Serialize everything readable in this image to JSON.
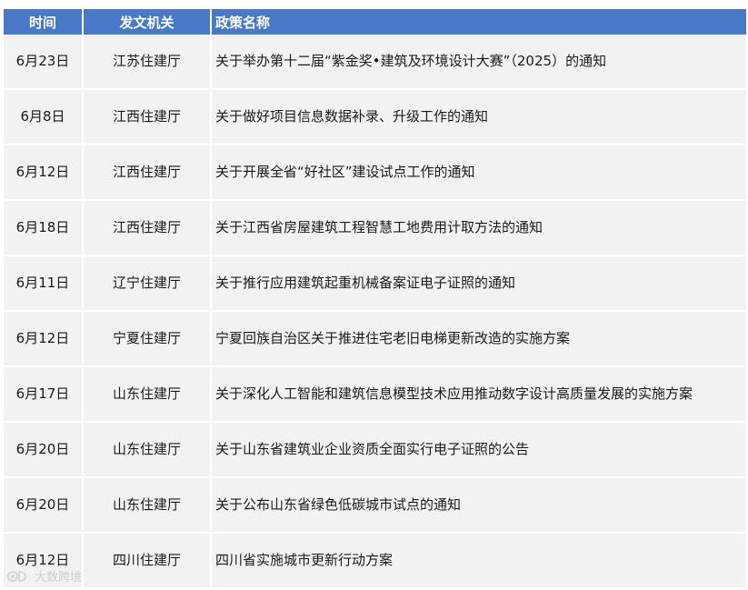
{
  "header": {
    "date": "时间",
    "org": "发文机关",
    "name": "政策名称"
  },
  "rows": [
    {
      "date": "6月23日",
      "org": "江苏住建厅",
      "name": "关于举办第十二届“紫金奖•建筑及环境设计大赛”（2025）的通知"
    },
    {
      "date": "6月8日",
      "org": "江西住建厅",
      "name": "关于做好项目信息数据补录、升级工作的通知"
    },
    {
      "date": "6月12日",
      "org": "江西住建厅",
      "name": "关于开展全省“好社区”建设试点工作的通知"
    },
    {
      "date": "6月18日",
      "org": "江西住建厅",
      "name": "关于江西省房屋建筑工程智慧工地费用计取方法的通知"
    },
    {
      "date": "6月11日",
      "org": "辽宁住建厅",
      "name": "关于推行应用建筑起重机械备案证电子证照的通知"
    },
    {
      "date": "6月12日",
      "org": "宁夏住建厅",
      "name": "宁夏回族自治区关于推进住宅老旧电梯更新改造的实施方案"
    },
    {
      "date": "6月17日",
      "org": "山东住建厅",
      "name": "关于深化人工智能和建筑信息模型技术应用推动数字设计高质量发展的实施方案"
    },
    {
      "date": "6月20日",
      "org": "山东住建厅",
      "name": "关于山东省建筑业企业资质全面实行电子证照的公告"
    },
    {
      "date": "6月20日",
      "org": "山东住建厅",
      "name": "关于公布山东省绿色低碳城市试点的通知"
    },
    {
      "date": "6月12日",
      "org": "四川住建厅",
      "name": "四川省实施城市更新行动方案"
    }
  ],
  "watermark": {
    "text": "大数跨境",
    "icon": "logo-mark-icon"
  },
  "colors": {
    "header_bg": "#4a78c8",
    "row_bg": "#f2f2f2"
  }
}
